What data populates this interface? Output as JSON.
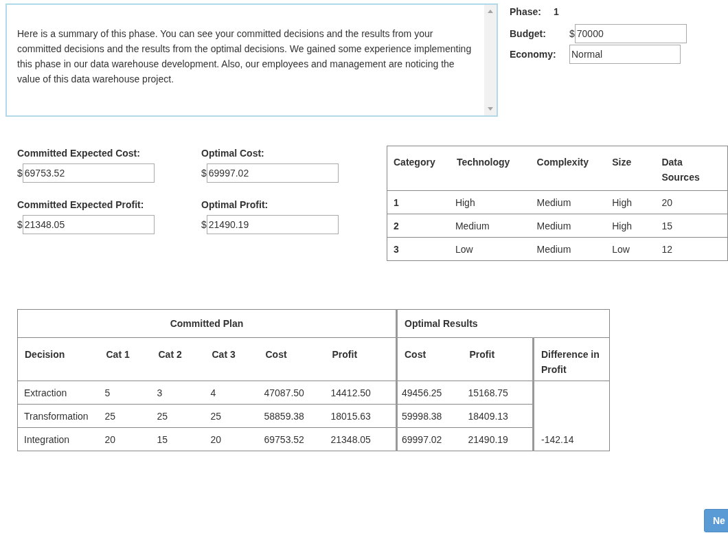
{
  "summary": {
    "text": "Here is a summary of this phase. You can see your committed decisions and the results from your committed decisions and the results from the optimal decisions. We gained some experience implementing this phase in our data warehouse development. Also, our employees and management are noticing the value of this data warehouse project."
  },
  "phase": {
    "label": "Phase:",
    "value": "1"
  },
  "info_fields": [
    {
      "label": "Budget:",
      "prefix": "$",
      "value": "70000"
    },
    {
      "label": "Economy:",
      "value": "Normal"
    }
  ],
  "fields": [
    {
      "label": "Committed Expected Cost:",
      "prefix": "$",
      "value": "69753.52"
    },
    {
      "label": "Optimal Cost:",
      "prefix": "$",
      "value": "69997.02"
    },
    {
      "label": "Committed Expected Profit:",
      "prefix": "$",
      "value": "21348.05"
    },
    {
      "label": "Optimal Profit:",
      "prefix": "$",
      "value": "21490.19"
    }
  ],
  "category_table": {
    "columns": [
      "Category",
      "Technology",
      "Complexity",
      "Size",
      "Data Sources"
    ],
    "rows": [
      [
        "1",
        "High",
        "Medium",
        "High",
        "20"
      ],
      [
        "2",
        "Medium",
        "Medium",
        "High",
        "15"
      ],
      [
        "3",
        "Low",
        "Medium",
        "Low",
        "12"
      ]
    ]
  },
  "results_table": {
    "group_headers": [
      "Committed Plan",
      "Optimal Results"
    ],
    "columns": [
      "Decision",
      "Cat 1",
      "Cat 2",
      "Cat 3",
      "Cost",
      "Profit",
      "Cost",
      "Profit",
      "Difference in Profit"
    ],
    "rows": [
      {
        "cells": [
          "Extraction",
          "5",
          "3",
          "4",
          "47087.50",
          "14412.50",
          "49456.25",
          "15168.75"
        ]
      },
      {
        "cells": [
          "Transformation",
          "25",
          "25",
          "25",
          "58859.38",
          "18015.63",
          "59998.38",
          "18409.13"
        ]
      },
      {
        "cells": [
          "Integration",
          "20",
          "15",
          "20",
          "69753.52",
          "21348.05",
          "69997.02",
          "21490.19"
        ],
        "difference": "-142.14"
      }
    ]
  },
  "next_button": {
    "label": "Ne"
  }
}
